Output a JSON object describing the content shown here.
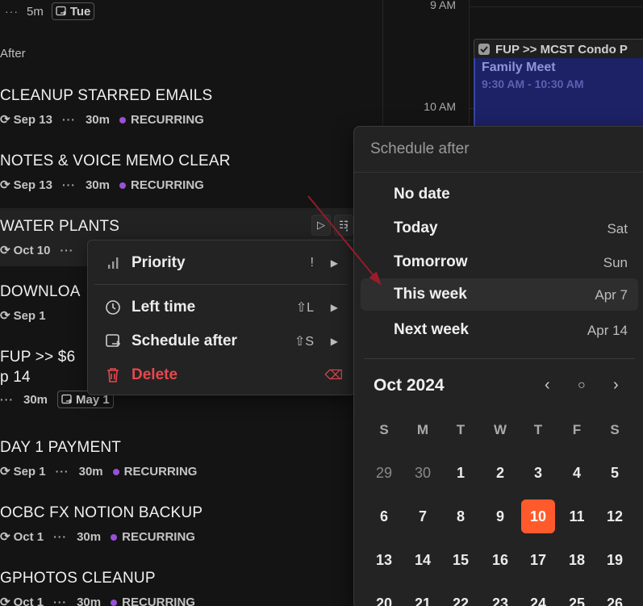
{
  "top_row": {
    "duration": "5m",
    "chip": "Tue"
  },
  "section_after": "After",
  "tasks": [
    {
      "title": "CLEANUP STARRED EMAILS",
      "date": "Sep 13",
      "duration": "30m",
      "tag": "RECURRING"
    },
    {
      "title": "NOTES & VOICE MEMO CLEAR",
      "date": "Sep 13",
      "duration": "30m",
      "tag": "RECURRING"
    },
    {
      "title": "WATER PLANTS",
      "date": "Oct 10"
    },
    {
      "title": "DOWNLOA",
      "date": "Sep 1"
    },
    {
      "title": "FUP >> $6",
      "title2": "p 14",
      "duration": "30m",
      "chip": "May 1"
    },
    {
      "title": "DAY 1 PAYMENT",
      "date": "Sep 1",
      "duration": "30m",
      "tag": "RECURRING"
    },
    {
      "title": "OCBC FX NOTION BACKUP",
      "date": "Oct 1",
      "duration": "30m",
      "tag": "RECURRING"
    },
    {
      "title": "GPHOTOS CLEANUP",
      "date": "Oct 1",
      "duration": "30m",
      "tag": "RECURRING"
    }
  ],
  "calendar": {
    "hours": [
      "9 AM",
      "10 AM"
    ],
    "event_fup": "FUP >> MCST Condo P",
    "event_family": {
      "name": "Family Meet",
      "time": "9:30 AM - 10:30 AM"
    }
  },
  "context_menu": {
    "items": [
      {
        "label": "Priority",
        "shortcut": "!",
        "icon": "bar-chart-icon"
      },
      {
        "label": "Left time",
        "shortcut": "⇧L",
        "icon": "clock-icon"
      },
      {
        "label": "Schedule after",
        "shortcut": "⇧S",
        "icon": "schedule-icon"
      },
      {
        "label": "Delete",
        "shortcut": "⌫",
        "icon": "trash-icon"
      }
    ]
  },
  "schedule_after": {
    "header": "Schedule after",
    "options": [
      {
        "label": "No date",
        "value": ""
      },
      {
        "label": "Today",
        "value": "Sat"
      },
      {
        "label": "Tomorrow",
        "value": "Sun"
      },
      {
        "label": "This week",
        "value": "Apr 7"
      },
      {
        "label": "Next week",
        "value": "Apr 14"
      }
    ],
    "month": "Oct 2024",
    "weekdays": [
      "S",
      "M",
      "T",
      "W",
      "T",
      "F",
      "S"
    ],
    "weeks": [
      [
        "29",
        "30",
        "1",
        "2",
        "3",
        "4",
        "5"
      ],
      [
        "6",
        "7",
        "8",
        "9",
        "10",
        "11",
        "12"
      ],
      [
        "13",
        "14",
        "15",
        "16",
        "17",
        "18",
        "19"
      ],
      [
        "20",
        "21",
        "22",
        "23",
        "24",
        "25",
        "26"
      ]
    ],
    "today": "10"
  },
  "colors": {
    "accent_today": "#ff5a2b",
    "recurring_dot": "#9b4fd6",
    "delete_red": "#e5484d",
    "event_blue": "#1d2266"
  }
}
